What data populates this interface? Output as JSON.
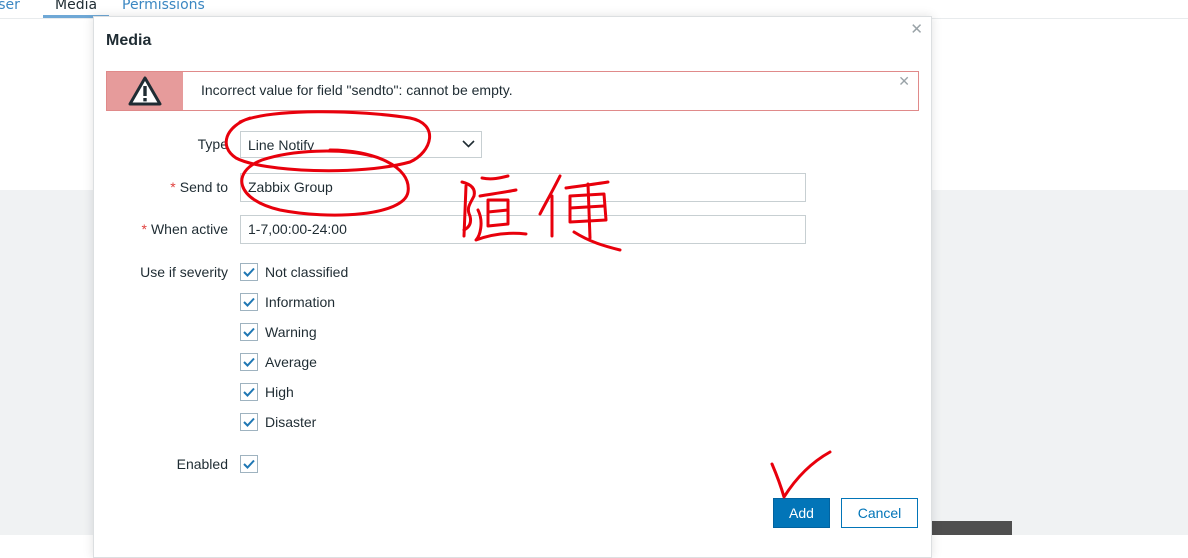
{
  "background": {
    "tabs": [
      {
        "label": "User"
      },
      {
        "label": "Media"
      },
      {
        "label": "Permissions"
      }
    ]
  },
  "dialog": {
    "title": "Media",
    "close_icon": "close-icon",
    "error": {
      "icon": "warning-icon",
      "text": "Incorrect value for field \"sendto\": cannot be empty."
    },
    "form": {
      "type": {
        "label": "Type",
        "value": "Line Notify"
      },
      "send_to": {
        "label": "Send to",
        "value": "Zabbix Group",
        "required": "*"
      },
      "when_active": {
        "label": "When active",
        "value": "1-7,00:00-24:00",
        "required": "*"
      },
      "severity": {
        "label": "Use if severity",
        "options": [
          {
            "label": "Not classified",
            "checked": true
          },
          {
            "label": "Information",
            "checked": true
          },
          {
            "label": "Warning",
            "checked": true
          },
          {
            "label": "Average",
            "checked": true
          },
          {
            "label": "High",
            "checked": true
          },
          {
            "label": "Disaster",
            "checked": true
          }
        ]
      },
      "enabled": {
        "label": "Enabled",
        "checked": true
      }
    },
    "buttons": {
      "add": "Add",
      "cancel": "Cancel"
    }
  },
  "annotation": {
    "handwritten_text": "随便",
    "color": "#e8000c"
  },
  "colors": {
    "primary": "#0275b8",
    "error_border": "#e08a8a",
    "error_icon_bg": "#e69b9b",
    "required": "#e0403d",
    "checkbox_check": "#1f77b4"
  }
}
